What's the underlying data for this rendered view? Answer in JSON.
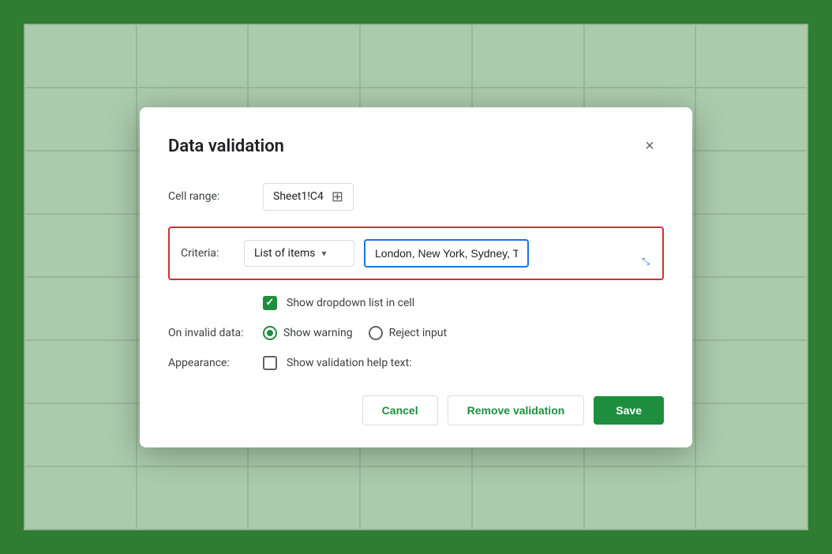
{
  "background": {
    "color": "#2e7d32"
  },
  "modal": {
    "title": "Data validation",
    "close_label": "×"
  },
  "cell_range": {
    "label": "Cell range:",
    "value": "Sheet1!C4",
    "grid_icon": "⊞"
  },
  "criteria": {
    "label": "Criteria:",
    "dropdown_label": "List of items",
    "text_input_value": "London, New York, Sydney, Tokyo",
    "text_input_placeholder": "London, New York, Sydney, Tokyo"
  },
  "show_dropdown": {
    "label": "Show dropdown list in cell",
    "checked": true
  },
  "on_invalid": {
    "label": "On invalid data:",
    "options": [
      {
        "label": "Show warning",
        "selected": true
      },
      {
        "label": "Reject input",
        "selected": false
      }
    ]
  },
  "appearance": {
    "label": "Appearance:",
    "checkbox_label": "Show validation help text:",
    "checked": false
  },
  "buttons": {
    "cancel": "Cancel",
    "remove": "Remove validation",
    "save": "Save"
  }
}
